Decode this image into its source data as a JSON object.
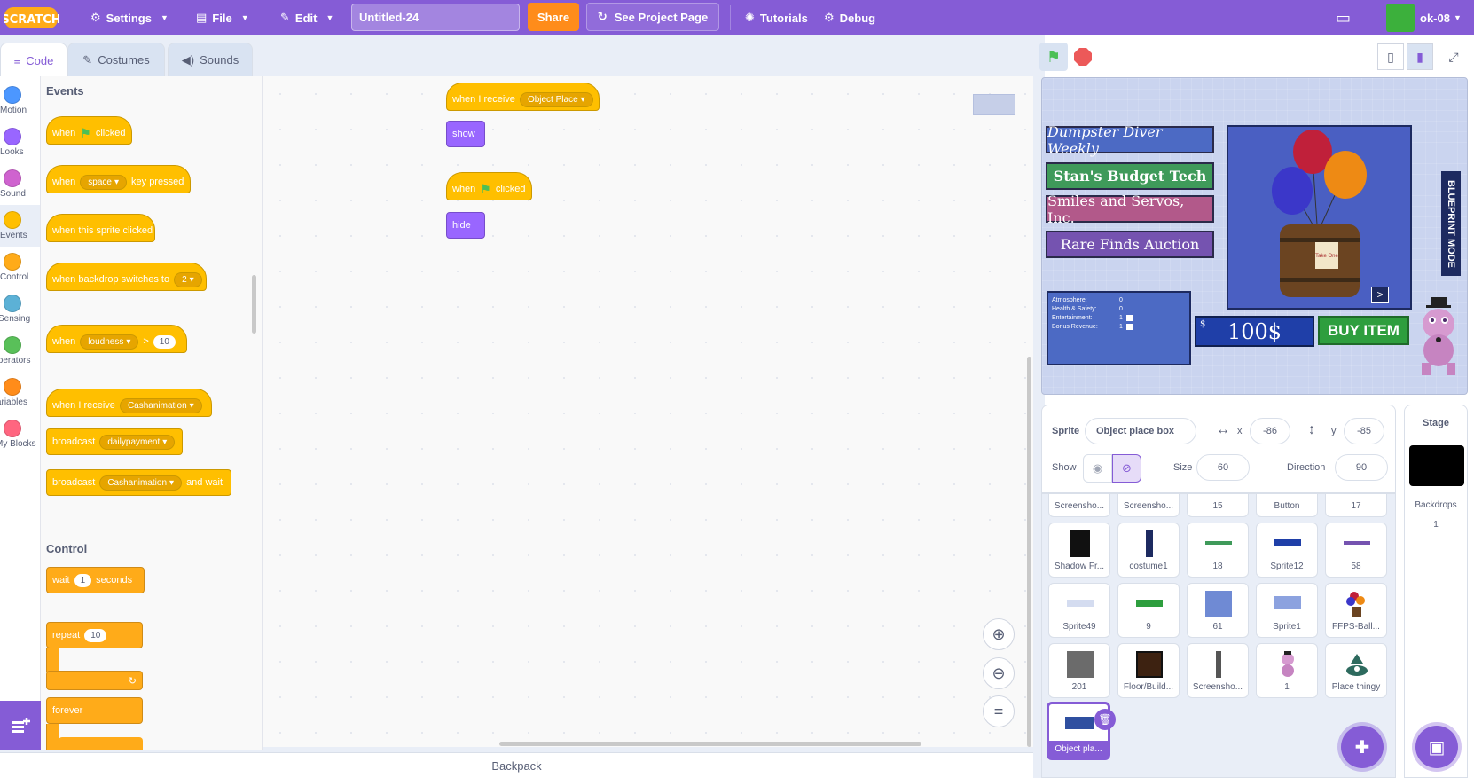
{
  "menubar": {
    "logo_text": "SCRATCH",
    "settings_label": "Settings",
    "file_label": "File",
    "edit_label": "Edit",
    "project_title": "Untitled-24",
    "share_label": "Share",
    "see_project_label": "See Project Page",
    "tutorials_label": "Tutorials",
    "debug_label": "Debug",
    "username": "ok-08"
  },
  "tabs": [
    {
      "label": "Code"
    },
    {
      "label": "Costumes"
    },
    {
      "label": "Sounds"
    }
  ],
  "categories": [
    {
      "label": "Motion",
      "color": "#4c97ff"
    },
    {
      "label": "Looks",
      "color": "#9966ff"
    },
    {
      "label": "Sound",
      "color": "#cf63cf"
    },
    {
      "label": "Events",
      "color": "#ffbf00"
    },
    {
      "label": "Control",
      "color": "#ffab19"
    },
    {
      "label": "Sensing",
      "color": "#5cb1d6"
    },
    {
      "label": "Operators",
      "color": "#59c059"
    },
    {
      "label": "Variables",
      "color": "#ff8c1a"
    },
    {
      "label": "My Blocks",
      "color": "#ff6680"
    }
  ],
  "palette": {
    "events_title": "Events",
    "control_title": "Control",
    "when": "when",
    "clicked": "clicked",
    "key_option": "space",
    "key_pressed": "key pressed",
    "sprite_clicked": "when this sprite clicked",
    "backdrop_switches": "when backdrop switches to",
    "backdrop_option": "2",
    "loudness_option": "loudness",
    "gt": ">",
    "loudness_value": "10",
    "when_i_receive": "when I receive",
    "receive_option": "Cashanimation",
    "broadcast": "broadcast",
    "broadcast_option": "dailypayment",
    "broadcast_wait_option": "Cashanimation",
    "and_wait": "and wait",
    "wait": "wait",
    "wait_value": "1",
    "seconds": "seconds",
    "repeat": "repeat",
    "repeat_value": "10",
    "forever": "forever"
  },
  "scripts": {
    "receive_label": "when I receive",
    "receive_option": "Object Place",
    "show_label": "show",
    "when_label": "when",
    "clicked_label": "clicked",
    "hide_label": "hide"
  },
  "backpack_label": "Backpack",
  "stage": {
    "buttons": [
      {
        "label": "Dumpster Diver Weekly",
        "color": "#4c6ac4"
      },
      {
        "label": "Stan's Budget Tech",
        "color": "#3f9a5a"
      },
      {
        "label": "Smiles and Servos, Inc.",
        "color": "#b2598a"
      },
      {
        "label": "Rare Finds Auction",
        "color": "#7553b0"
      }
    ],
    "stats": [
      {
        "label": "Atmosphere:",
        "value": "0"
      },
      {
        "label": "Health & Safety:",
        "value": "0"
      },
      {
        "label": "Entertainment:",
        "value": "1"
      },
      {
        "label": "Bonus Revenue:",
        "value": "1"
      }
    ],
    "money": "100$",
    "money_symbol": "$",
    "buy_label": "BUY ITEM",
    "blueprint_label": "BLUEPRINT MODE",
    "poster_sign": "Take One",
    "next_arrow": ">"
  },
  "sprite_info": {
    "sprite_label": "Sprite",
    "sprite_name": "Object place box",
    "x_label": "x",
    "x_value": "-86",
    "y_label": "y",
    "y_value": "-85",
    "show_label": "Show",
    "size_label": "Size",
    "size_value": "60",
    "direction_label": "Direction",
    "direction_value": "90"
  },
  "sprites": [
    {
      "name": "Screensho...",
      "icon": "thumb"
    },
    {
      "name": "Screensho...",
      "icon": "thumb"
    },
    {
      "name": "15",
      "icon": "thumb"
    },
    {
      "name": "Button",
      "icon": "thumb"
    },
    {
      "name": "17",
      "icon": "thumb"
    },
    {
      "name": "Shadow Fr...",
      "icon": "thumb-dark"
    },
    {
      "name": "costume1",
      "icon": "thumb-bar"
    },
    {
      "name": "18",
      "icon": "thumb-green"
    },
    {
      "name": "Sprite12",
      "icon": "thumb-blue"
    },
    {
      "name": "58",
      "icon": "thumb-purple"
    },
    {
      "name": "Sprite49",
      "icon": "thumb-light"
    },
    {
      "name": "9",
      "icon": "thumb-green"
    },
    {
      "name": "61",
      "icon": "thumb-square"
    },
    {
      "name": "Sprite1",
      "icon": "thumb-blue"
    },
    {
      "name": "FFPS-Ball...",
      "icon": "balloons-icon"
    },
    {
      "name": "201",
      "icon": "thumb-gray"
    },
    {
      "name": "Floor/Build...",
      "icon": "thumb-brown"
    },
    {
      "name": "Screensho...",
      "icon": "thumb-bar"
    },
    {
      "name": "1",
      "icon": "character-icon"
    },
    {
      "name": "Place thingy",
      "icon": "thumb-teal"
    },
    {
      "name": "Object pla...",
      "icon": "thumb-selected"
    }
  ],
  "stage_panel": {
    "title": "Stage",
    "backdrops_label": "Backdrops",
    "backdrops_count": "1"
  }
}
